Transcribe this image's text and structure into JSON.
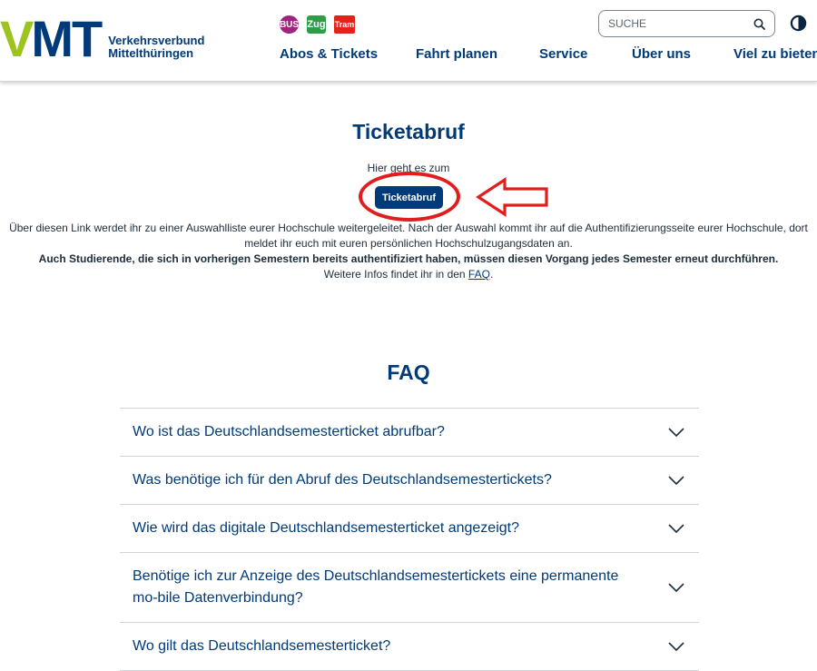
{
  "header": {
    "logo": {
      "mark_v": "V",
      "mark_mt": "MT",
      "line1": "Verkehrsverbund",
      "line2": "Mittelthüringen"
    },
    "modes": [
      {
        "label": "BUS",
        "color": "#a2237f"
      },
      {
        "label": "Zug",
        "color": "#2e9d47"
      },
      {
        "label": "Tram",
        "color": "#e2231a"
      }
    ],
    "nav": [
      "Abos & Tickets",
      "Fahrt planen",
      "Service",
      "Über uns",
      "Viel zu bieten"
    ],
    "search": {
      "placeholder": "SUCHE",
      "icon": "search-icon"
    },
    "contrast_icon": "contrast-icon"
  },
  "main": {
    "title": "Ticketabruf",
    "subtitle": "Hier geht es zum",
    "button_label": "Ticketabruf",
    "info_line1": "Über diesen Link werdet ihr zu einer Auswahlliste eurer Hochschule weitergeleitet. Nach der Auswahl kommt ihr auf die Authentifizierungsseite eurer Hochschule, dort",
    "info_line2": "meldet ihr euch mit euren persönlichen Hochschulzugangsdaten an.",
    "info_bold": "Auch Studierende, die sich in vorherigen Semestern bereits authentifiziert haben, müssen diesen Vorgang jedes Semester erneut durchführen.",
    "info_more_prefix": "Weitere Infos findet ihr in den ",
    "info_more_link": "FAQ",
    "info_more_suffix": "."
  },
  "faq": {
    "title": "FAQ",
    "items": [
      "Wo ist das Deutschlandsemesterticket abrufbar?",
      "Was benötige ich für den Abruf des Deutschlandsemestertickets?",
      "Wie wird das digitale Deutschlandsemesterticket angezeigt?",
      "Benötige ich zur Anzeige des Deutschlandsemestertickets eine permanente mo-bile Datenverbindung?",
      "Wo gilt das Deutschlandsemesterticket?"
    ]
  },
  "colors": {
    "brand_blue": "#003a78",
    "brand_green": "#9cc31f",
    "annotation_red": "#e01e1e"
  }
}
